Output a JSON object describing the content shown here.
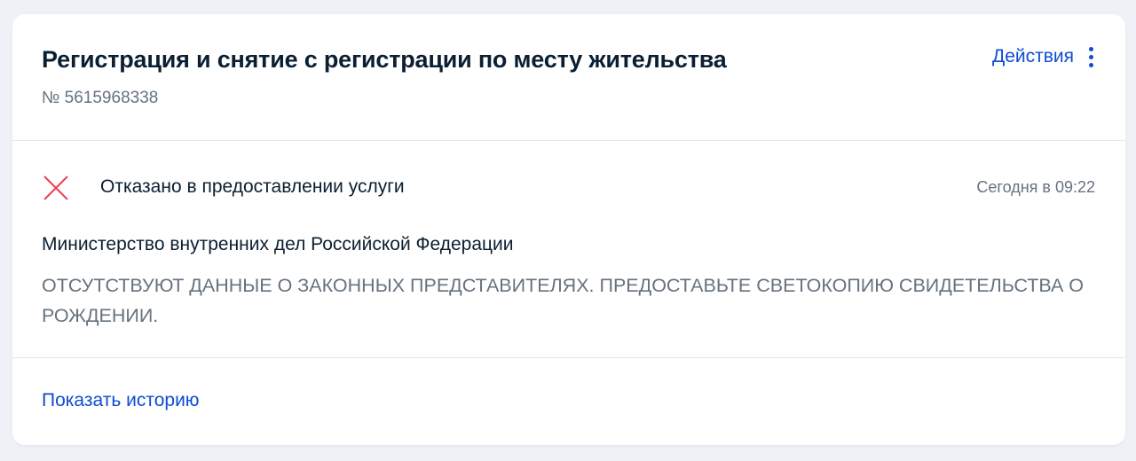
{
  "card": {
    "title": "Регистрация и снятие с регистрации по месту жительства",
    "number": "№ 5615968338",
    "actions_label": "Действия"
  },
  "status": {
    "icon": "close-icon",
    "icon_color": "#ee3f58",
    "text": "Отказано в предоставлении услуги",
    "time": "Сегодня в 09:22",
    "ministry": "Министерство внутренних дел Российской Федерации",
    "message": "ОТСУТСТВУЮТ ДАННЫЕ О ЗАКОННЫХ ПРЕДСТАВИТЕЛЯХ. ПРЕДОСТАВЬТЕ СВЕТОКОПИЮ СВИДЕТЕЛЬСТВА О РОЖДЕНИИ."
  },
  "footer": {
    "history_link": "Показать историю"
  },
  "colors": {
    "accent": "#0d4cd3",
    "text_primary": "#0b1f33",
    "text_secondary": "#66727f",
    "background": "#eef1f6"
  }
}
